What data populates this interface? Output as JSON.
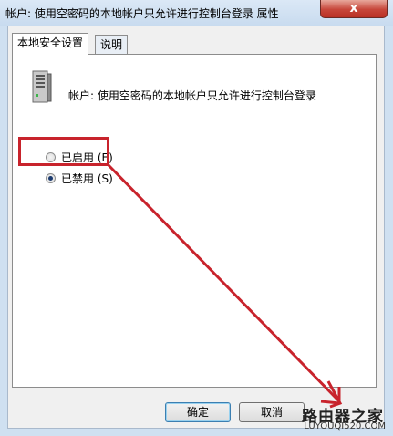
{
  "window": {
    "title": "帐户: 使用空密码的本地帐户只允许进行控制台登录 属性",
    "close_label": "x"
  },
  "tabs": [
    {
      "label": "本地安全设置",
      "active": true
    },
    {
      "label": "说明",
      "active": false
    }
  ],
  "policy": {
    "icon": "server-icon",
    "name": "帐户: 使用空密码的本地帐户只允许进行控制台登录"
  },
  "options": [
    {
      "label": "已启用 (E)",
      "checked": false
    },
    {
      "label": "已禁用 (S)",
      "checked": true
    }
  ],
  "buttons": {
    "ok": "确定",
    "cancel": "取消"
  },
  "watermark": {
    "top": "路由器之家",
    "bottom": "LUYOUQI520.COM"
  },
  "colors": {
    "annotation": "#c8232c",
    "titlebar": "#cfe0f1"
  }
}
